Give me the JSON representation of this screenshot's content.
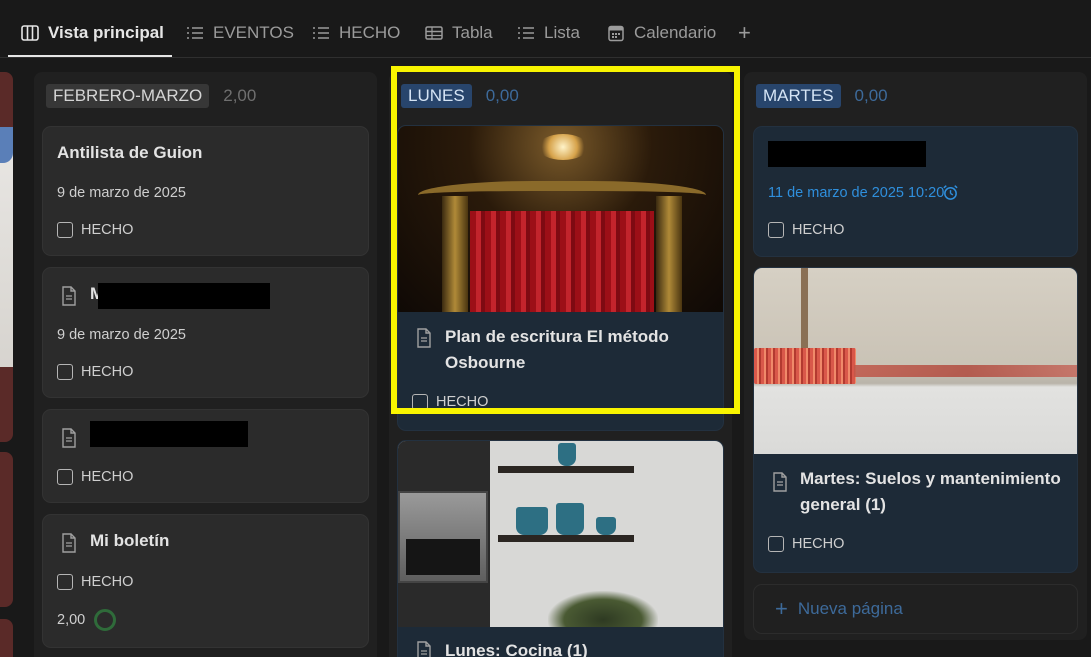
{
  "tabs": [
    {
      "label": "Vista principal",
      "icon": "board-icon",
      "active": true
    },
    {
      "label": "EVENTOS",
      "icon": "list-icon"
    },
    {
      "label": "HECHO",
      "icon": "list-icon"
    },
    {
      "label": "Tabla",
      "icon": "table-icon"
    },
    {
      "label": "Lista",
      "icon": "list-icon"
    },
    {
      "label": "Calendario",
      "icon": "calendar-icon"
    }
  ],
  "add_tab": "+",
  "columns": [
    {
      "name": "FEBRERO-MARZO",
      "count": "2,00",
      "cards": [
        {
          "title": "Antilista de Guion",
          "date": "9 de marzo de 2025",
          "check": "HECHO"
        },
        {
          "title": "M",
          "date": "9 de marzo de 2025",
          "check": "HECHO"
        },
        {
          "title": "",
          "check": "HECHO"
        },
        {
          "title": "Mi boletín",
          "check": "HECHO",
          "progress": "2,00"
        }
      ]
    },
    {
      "name": "LUNES",
      "count": "0,00",
      "cards": [
        {
          "title_line1": "Plan de escritura El método",
          "title_line2": "Osbourne",
          "check": "HECHO"
        },
        {
          "title": "Lunes: Cocina (1)"
        }
      ]
    },
    {
      "name": "MARTES",
      "count": "0,00",
      "cards": [
        {
          "title": "",
          "date": "11 de marzo de 2025 10:20",
          "check": "HECHO"
        },
        {
          "title_line1": "Martes: Suelos y mantenimiento",
          "title_line2": "general (1)",
          "check": "HECHO"
        }
      ]
    }
  ],
  "new_page": "Nueva página",
  "colors": {
    "highlight": "#f8f400",
    "date_blue": "#2f8fdc",
    "tag_blue": "#28456c"
  }
}
